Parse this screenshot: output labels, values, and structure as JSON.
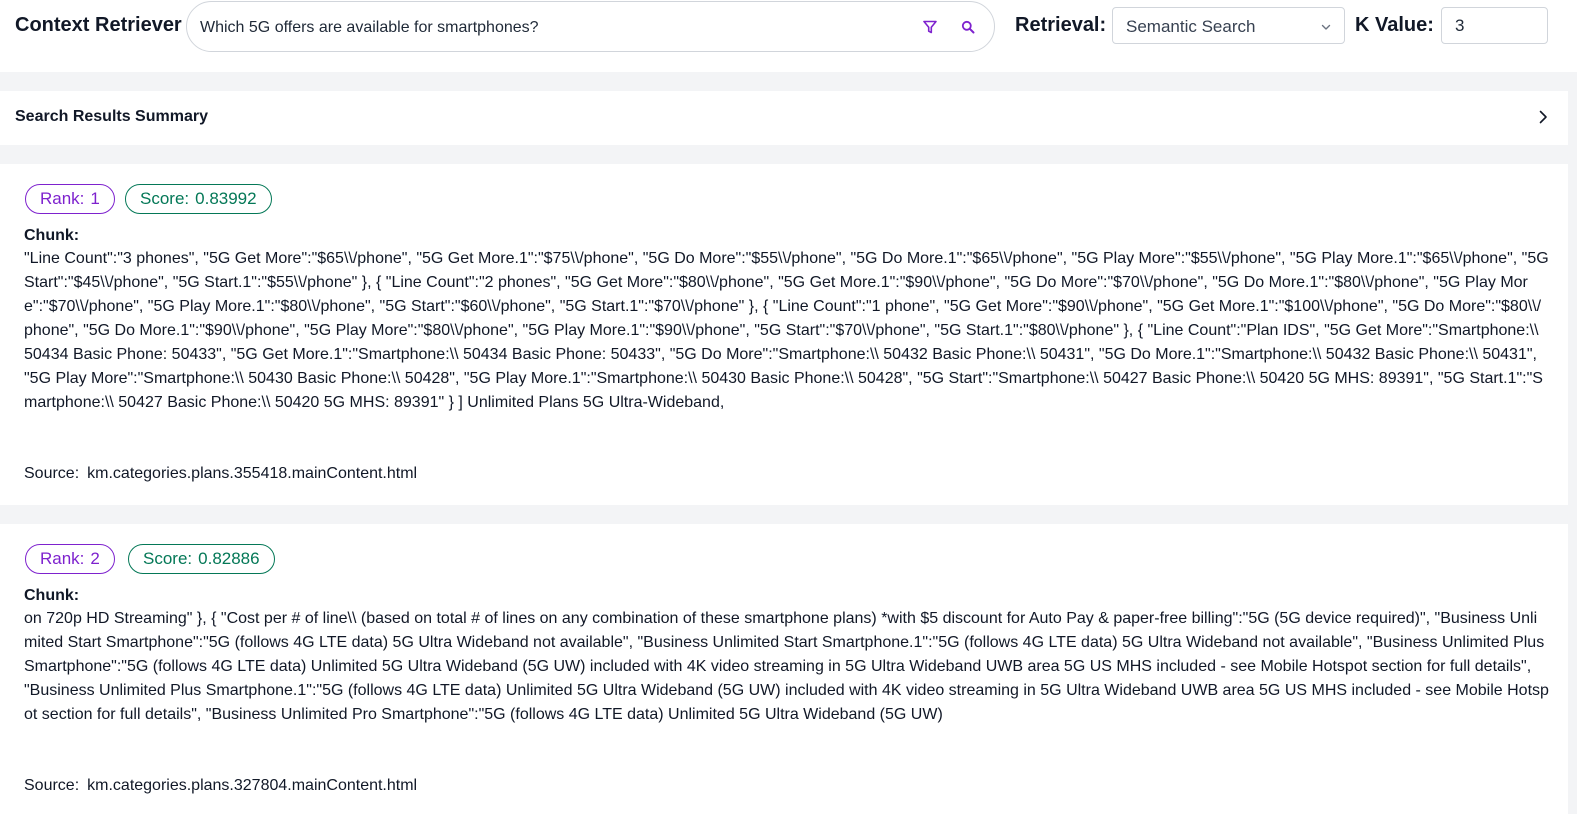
{
  "header": {
    "title": "Context Retriever",
    "query": "Which 5G offers are available for smartphones?",
    "retrieval_label": "Retrieval:",
    "retrieval_value": "Semantic Search",
    "k_label": "K Value:",
    "k_value": "3",
    "icons": [
      "filter-icon",
      "search-icon",
      "chevron-down-icon"
    ],
    "accent_color": "#7e22ce"
  },
  "summary": {
    "title": "Search Results Summary",
    "icon": "chevron-right-icon"
  },
  "results": [
    {
      "rank_label": "Rank:",
      "rank": "1",
      "score_label": "Score:",
      "score": "0.83992",
      "chunk_label": "Chunk:",
      "chunk": "\"Line Count\":\"3 phones\", \"5G Get More\":\"$65\\\\/phone\", \"5G Get More.1\":\"$75\\\\/phone\", \"5G Do More\":\"$55\\\\/phone\", \"5G Do More.1\":\"$65\\\\/phone\", \"5G Play More\":\"$55\\\\/phone\", \"5G Play More.1\":\"$65\\\\/phone\", \"5G Start\":\"$45\\\\/phone\", \"5G Start.1\":\"$55\\\\/phone\" }, { \"Line Count\":\"2 phones\", \"5G Get More\":\"$80\\\\/phone\", \"5G Get More.1\":\"$90\\\\/phone\", \"5G Do More\":\"$70\\\\/phone\", \"5G Do More.1\":\"$80\\\\/phone\", \"5G Play More\":\"$70\\\\/phone\", \"5G Play More.1\":\"$80\\\\/phone\", \"5G Start\":\"$60\\\\/phone\", \"5G Start.1\":\"$70\\\\/phone\" }, { \"Line Count\":\"1 phone\", \"5G Get More\":\"$90\\\\/phone\", \"5G Get More.1\":\"$100\\\\/phone\", \"5G Do More\":\"$80\\\\/phone\", \"5G Do More.1\":\"$90\\\\/phone\", \"5G Play More\":\"$80\\\\/phone\", \"5G Play More.1\":\"$90\\\\/phone\", \"5G Start\":\"$70\\\\/phone\", \"5G Start.1\":\"$80\\\\/phone\" }, { \"Line Count\":\"Plan IDS\", \"5G Get More\":\"Smartphone:\\\\ 50434 Basic Phone: 50433\", \"5G Get More.1\":\"Smartphone:\\\\ 50434 Basic Phone: 50433\", \"5G Do More\":\"Smartphone:\\\\ 50432 Basic Phone:\\\\ 50431\", \"5G Do More.1\":\"Smartphone:\\\\ 50432 Basic Phone:\\\\ 50431\", \"5G Play More\":\"Smartphone:\\\\ 50430 Basic Phone:\\\\ 50428\", \"5G Play More.1\":\"Smartphone:\\\\ 50430 Basic Phone:\\\\ 50428\", \"5G Start\":\"Smartphone:\\\\ 50427 Basic Phone:\\\\ 50420 5G MHS: 89391\", \"5G Start.1\":\"Smartphone:\\\\ 50427 Basic Phone:\\\\ 50420 5G MHS: 89391\" } ] Unlimited Plans 5G Ultra-Wideband,",
      "source_label": "Source:",
      "source": "km.categories.plans.355418.mainContent.html"
    },
    {
      "rank_label": "Rank:",
      "rank": "2",
      "score_label": "Score:",
      "score": "0.82886",
      "chunk_label": "Chunk:",
      "chunk": "on 720p HD Streaming\" }, { \"Cost per # of line\\\\ (based on total # of lines on any combination of these smartphone plans) *with $5 discount for Auto Pay & paper-free billing\":\"5G (5G device required)\", \"Business Unlimited Start Smartphone\":\"5G (follows 4G LTE data) 5G Ultra Wideband not available\", \"Business Unlimited Start Smartphone.1\":\"5G (follows 4G LTE data) 5G Ultra Wideband not available\", \"Business Unlimited Plus Smartphone\":\"5G (follows 4G LTE data) Unlimited 5G Ultra Wideband (5G UW) included with 4K video streaming in 5G Ultra Wideband UWB area 5G US MHS included - see Mobile Hotspot section for full details\", \"Business Unlimited Plus Smartphone.1\":\"5G (follows 4G LTE data) Unlimited 5G Ultra Wideband (5G UW) included with 4K video streaming in 5G Ultra Wideband UWB area 5G US MHS included - see Mobile Hotspot section for full details\", \"Business Unlimited Pro Smartphone\":\"5G (follows 4G LTE data) Unlimited 5G Ultra Wideband (5G UW)",
      "source_label": "Source:",
      "source": "km.categories.plans.327804.mainContent.html"
    }
  ]
}
